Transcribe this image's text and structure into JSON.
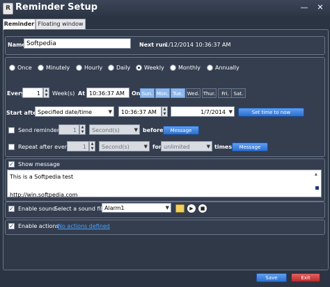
{
  "window": {
    "title": "Reminder Setup",
    "icon": "R",
    "minimize": "—",
    "close": "✕"
  },
  "tabs": [
    {
      "label": "Reminder",
      "active": true
    },
    {
      "label": "Floating window",
      "active": false
    }
  ],
  "name_row": {
    "name_label": "Name",
    "name_value": "Softpedia",
    "next_run_label": "Next run",
    "next_run_value": "1/12/2014 10:36:37 AM"
  },
  "frequency": {
    "options": [
      "Once",
      "Minutely",
      "Hourly",
      "Daily",
      "Weekly",
      "Monthly",
      "Annually"
    ],
    "selected": "Weekly"
  },
  "schedule": {
    "every_label": "Every",
    "every_value": "1",
    "unit_label": "Week(s)",
    "at_label": "At",
    "at_value": "10:36:37 AM",
    "on_label": "On",
    "days": [
      {
        "label": "Sun.",
        "selected": true
      },
      {
        "label": "Mon.",
        "selected": true
      },
      {
        "label": "Tue.",
        "selected": true
      },
      {
        "label": "Wed.",
        "selected": false
      },
      {
        "label": "Thur.",
        "selected": false
      },
      {
        "label": "Fri.",
        "selected": false
      },
      {
        "label": "Sat.",
        "selected": false
      }
    ],
    "start_after_label": "Start after",
    "start_after_value": "Specified date/time",
    "start_time_value": "10:36:37 AM",
    "start_date_value": "1/7/2014",
    "set_time_button": "Set time to now"
  },
  "send_reminder": {
    "label": "Send reminder",
    "value": "1",
    "unit": "Second(s)",
    "before_label": "before",
    "message_button": "Message"
  },
  "repeat": {
    "label": "Repeat after every",
    "value": "1",
    "unit": "Second(s)",
    "for_label": "for",
    "for_value": "unlimited",
    "times_label": "times",
    "message_button": "Message"
  },
  "show_message": {
    "label": "Show message",
    "lines": [
      "This is a Softpedia test",
      "",
      "http://win.softpedia.com"
    ]
  },
  "sound": {
    "label": "Enable sound",
    "select_label": "Select a sound file",
    "file_value": "Alarm1"
  },
  "actions": {
    "label": "Enable actions",
    "link": "No actions defined"
  },
  "footer": {
    "save": "Save",
    "exit": "Exit"
  }
}
